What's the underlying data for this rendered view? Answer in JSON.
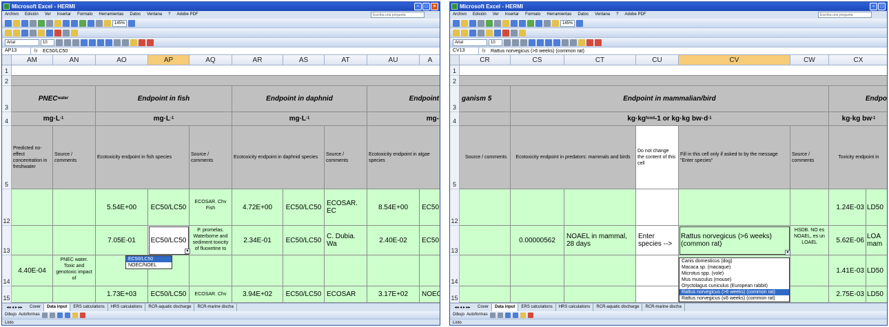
{
  "left": {
    "title": "Microsoft Excel - HERMI",
    "menu": [
      "Archivo",
      "Edición",
      "Ver",
      "Insertar",
      "Formato",
      "Herramientas",
      "Datos",
      "Ventana",
      "?",
      "Adobe PDF"
    ],
    "help_placeholder": "Escriba una pregunta",
    "font_name": "Arial",
    "font_size": "10",
    "zoom": "145%",
    "name_box": "AP13",
    "formula": "EC50/LC50",
    "columns": [
      "AM",
      "AN",
      "AO",
      "AP",
      "AQ",
      "AR",
      "AS",
      "AT",
      "AU",
      "A"
    ],
    "rows": [
      "1",
      "2",
      "3",
      "4",
      "5",
      "12",
      "13",
      "14",
      "15"
    ],
    "hdr_pnec": "PNEC",
    "hdr_pnec_sub": "water",
    "hdr_fish": "Endpoint in fish",
    "hdr_daphnid": "Endpoint in daphnid",
    "hdr_endpoint": "Endpoint",
    "unit_mgl": "mg·L",
    "unit_mgl_sup": "-1",
    "unit_mg": "mg-",
    "desc_pnec": "Predicted no-effect concentration in freshwater",
    "desc_source": "Source / comments",
    "desc_fish": "Ecotoxicity endpoint in fish species",
    "desc_daphnid": "Ecotoxicity endpoint in daphnid species",
    "desc_algae": "Ecotoxicity endpoint in algae species",
    "r12": {
      "ao": "5.54E+00",
      "ap": "EC50/LC50",
      "aq": "ECOSAR. Chv Fish",
      "ar": "4.72E+00",
      "as": "EC50/LC50",
      "at": "ECOSAR. EC",
      "au": "8.54E+00",
      "av": "EC50"
    },
    "r13": {
      "ao": "7.05E-01",
      "ap": "EC50/LC50",
      "aq": "P. promelas. Waterborne and sediment toxicity of fluoxetine to",
      "ar": "2.34E-01",
      "as": "EC50/LC50",
      "at": "C. Dubia. Wa",
      "au": "2.40E-02",
      "av": "EC50"
    },
    "r14": {
      "am": "4.40E-04",
      "an": "PNEC water. Toxic and genotoxic impact of"
    },
    "r15": {
      "ao": "1.73E+03",
      "ap": "EC50/LC50",
      "aq": "ECOSAR. Chv",
      "ar": "3.94E+02",
      "as": "EC50/LC50",
      "at": "ECOSAR",
      "au": "3.17E+02",
      "av": "NOEC"
    },
    "dropdown": [
      "EC50/LC50",
      "NOEC/NOEL"
    ],
    "dropdown_selected": 0,
    "tabs": [
      "Cover",
      "Data input",
      "ERS calculations",
      "HRS calculations",
      "RCR-aquatic discharge",
      "RCR-marine discha"
    ],
    "active_tab": "Data input",
    "draw_label": "Dibujo",
    "autoshapes_label": "Autoformas",
    "status": "Listo"
  },
  "right": {
    "title": "Microsoft Excel - HERMI",
    "menu": [
      "Archivo",
      "Edición",
      "Ver",
      "Insertar",
      "Formato",
      "Herramientas",
      "Datos",
      "Ventana",
      "?",
      "Adobe PDF"
    ],
    "help_placeholder": "Escriba una pregunta",
    "font_name": "Arial",
    "font_size": "10",
    "zoom": "145%",
    "name_box": "CV13",
    "formula": "Rattus norvegicus (>6 weeks) (common rat)",
    "columns": [
      "CR",
      "CS",
      "CT",
      "CU",
      "CV",
      "CW",
      "CX"
    ],
    "rows": [
      "1",
      "2",
      "3",
      "4",
      "5",
      "12",
      "13",
      "14",
      "15"
    ],
    "hdr_organism": "ganism 5",
    "hdr_mammal": "Endpoint in mammalian/bird",
    "hdr_endp": "Endpo",
    "unit_kg": "kg·kg",
    "unit_kg_sub": "food",
    "unit_kg_mid": "-1 or kg·kg bw·d",
    "unit_kg_sup": "-1",
    "unit_kgbw": "kg·kg bw",
    "unit_kgbw_sup": "-1",
    "desc_source": "Source / comments",
    "desc_predators": "Ecotoxicity endpoint in predators: mammals and birds",
    "desc_donot": "Do not change the content of this cell",
    "desc_fill": "Fill in this cell only if asked to by the message \"Enter species\"",
    "desc_source2": "Source / comments",
    "desc_tox": "Toxicity endpoint in",
    "r12": {
      "cx": "1.24E-03",
      "cy": "LD50"
    },
    "r13": {
      "cs": "0.00000562",
      "ct": "NOAEL in mammal, 28 days",
      "cu": "Enter species -->",
      "cv": "Rattus norvegicus (>6 weeks) (common rat)",
      "cw": "HSDB. NO es NOAEL, es un LOAEL",
      "cx": "5.62E-06",
      "cy": "LOA mam"
    },
    "r14": {
      "cx": "1.41E-03",
      "cy": "LD50"
    },
    "r15": {
      "cx": "2.75E-03",
      "cy": "LD50"
    },
    "dropdown": [
      "Canis domesticus (dog)",
      "Macaca sp. (macaque)",
      "Microtus spp. (vole)",
      "Mus musculus (mouse)",
      "Oryctolagus cuniculus (European rabbit)",
      "Rattus norvegicus (>6 weeks) (common rat)",
      "Rattus norvegicus (≤6 weeks) (common rat)"
    ],
    "dropdown_selected": 5,
    "tabs": [
      "Cover",
      "Data input",
      "ERS calculations",
      "HRS calculations",
      "RCR-aquatic discharge",
      "RCR-marine discha"
    ],
    "active_tab": "Data input",
    "draw_label": "Dibujo",
    "autoshapes_label": "Autoformas",
    "status": "Listo"
  }
}
